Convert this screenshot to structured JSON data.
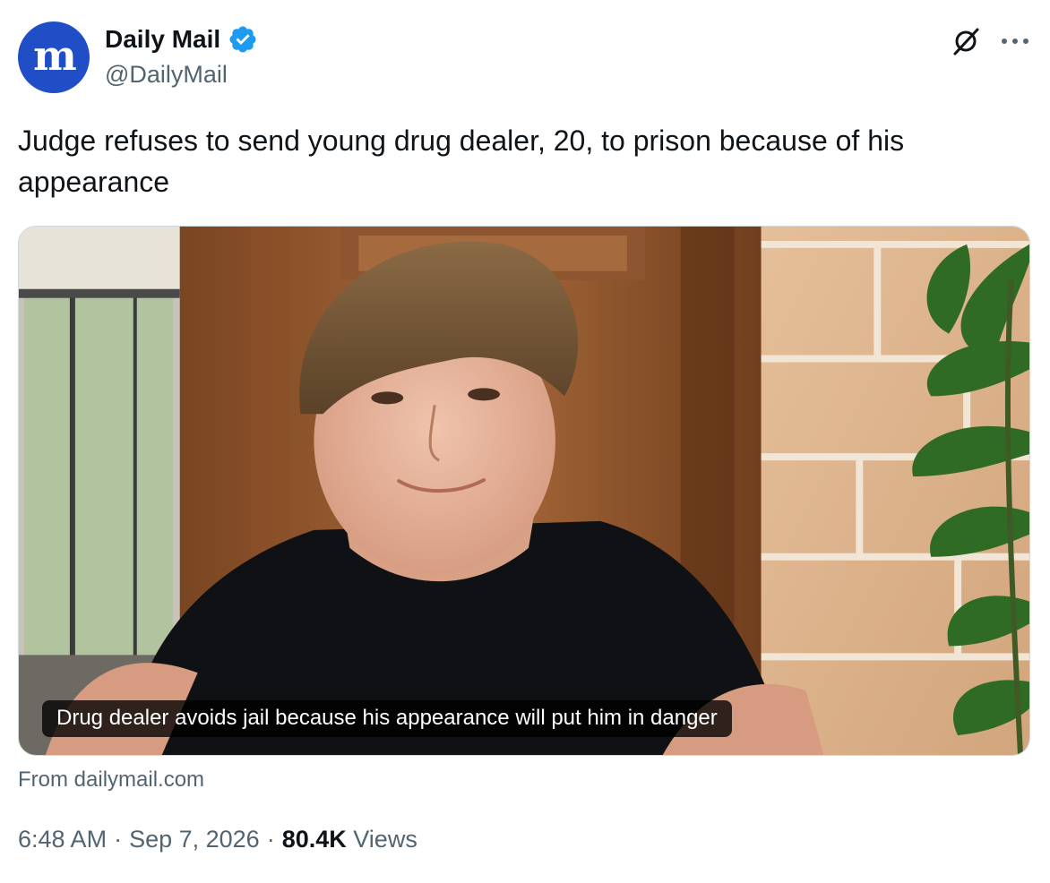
{
  "account": {
    "display_name": "Daily Mail",
    "handle": "@DailyMail",
    "avatar_letter": "m",
    "verified": true,
    "avatar_color": "#1f4ec6",
    "verified_color": "#1d9bf0"
  },
  "tweet": {
    "text": "Judge refuses to send young drug dealer, 20, to prison because of his appearance"
  },
  "media": {
    "caption": "Drug dealer avoids jail because his appearance will put him in danger",
    "source": "From dailymail.com"
  },
  "meta": {
    "time": "6:48 AM",
    "date": "Sep 7, 2026",
    "views_count": "80.4K",
    "views_label": "Views",
    "separator": "·"
  },
  "icons": {
    "grok": "grok-icon",
    "more": "more-options-icon",
    "verified": "verified-badge-icon"
  }
}
